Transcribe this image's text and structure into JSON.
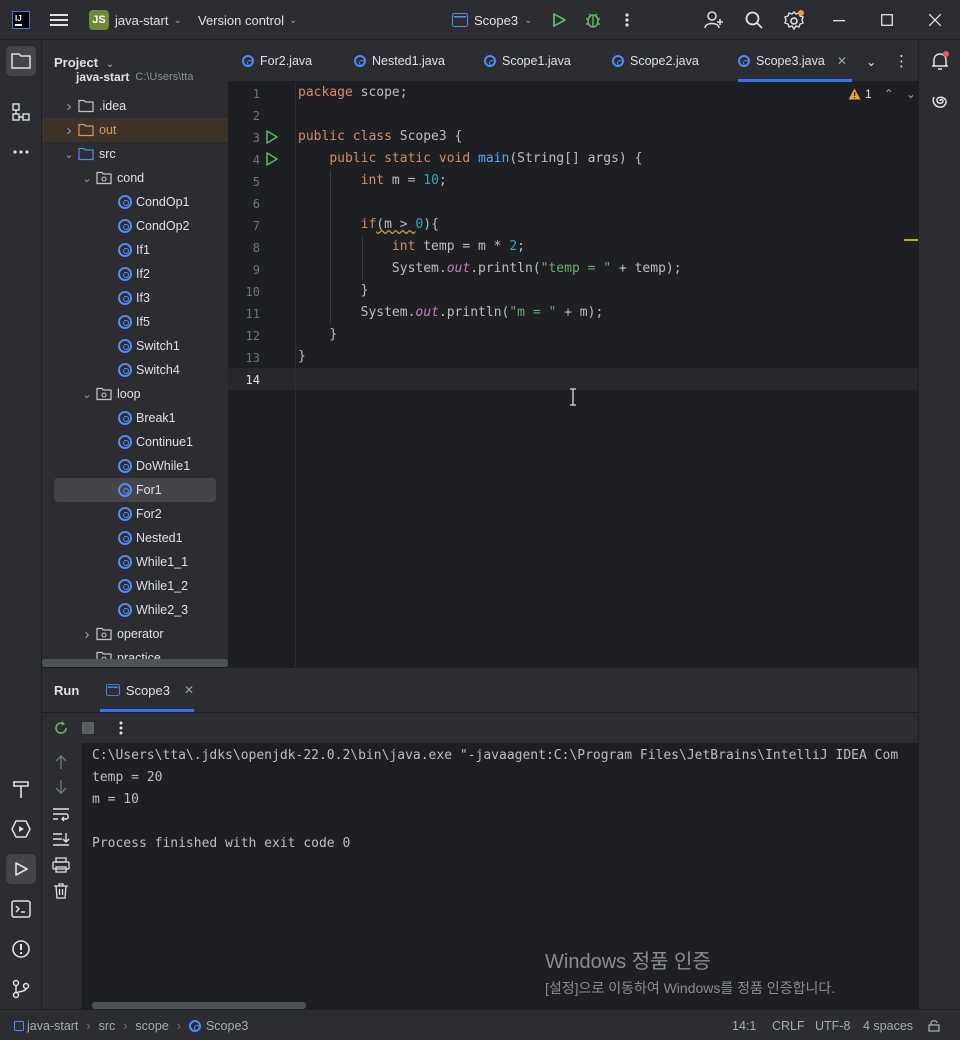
{
  "titlebar": {
    "project_badge": "JS",
    "project_name": "java-start",
    "version_control": "Version control",
    "run_config": "Scope3"
  },
  "project_panel": {
    "title": "Project",
    "root": "java-start",
    "root_path": "C:\\Users\\tta",
    "items": [
      {
        "label": ".idea",
        "kind": "folder"
      },
      {
        "label": "out",
        "kind": "folder-excluded"
      },
      {
        "label": "src",
        "kind": "source-root"
      },
      {
        "label": "cond",
        "kind": "package"
      },
      {
        "label": "CondOp1",
        "kind": "class"
      },
      {
        "label": "CondOp2",
        "kind": "class"
      },
      {
        "label": "If1",
        "kind": "class"
      },
      {
        "label": "If2",
        "kind": "class"
      },
      {
        "label": "If3",
        "kind": "class"
      },
      {
        "label": "If5",
        "kind": "class"
      },
      {
        "label": "Switch1",
        "kind": "class"
      },
      {
        "label": "Switch4",
        "kind": "class"
      },
      {
        "label": "loop",
        "kind": "package"
      },
      {
        "label": "Break1",
        "kind": "class"
      },
      {
        "label": "Continue1",
        "kind": "class"
      },
      {
        "label": "DoWhile1",
        "kind": "class"
      },
      {
        "label": "For1",
        "kind": "class"
      },
      {
        "label": "For2",
        "kind": "class"
      },
      {
        "label": "Nested1",
        "kind": "class"
      },
      {
        "label": "While1_1",
        "kind": "class"
      },
      {
        "label": "While1_2",
        "kind": "class"
      },
      {
        "label": "While2_3",
        "kind": "class"
      },
      {
        "label": "operator",
        "kind": "package"
      },
      {
        "label": "practice",
        "kind": "package"
      }
    ]
  },
  "editor": {
    "tabs": [
      "For2.java",
      "Nested1.java",
      "Scope1.java",
      "Scope2.java",
      "Scope3.java"
    ],
    "active_tab": "Scope3.java",
    "warning_count": "1",
    "line_numbers": [
      "1",
      "2",
      "3",
      "4",
      "5",
      "6",
      "7",
      "8",
      "9",
      "10",
      "11",
      "12",
      "13",
      "14"
    ],
    "code": {
      "l1_kw": "package",
      "l1_rest": " scope;",
      "l3_kw": "public class",
      "l3_rest": " Scope3 {",
      "l4_kw": "public static void",
      "l4_fn": "main",
      "l4_rest": "(String[] args) {",
      "l5_kw": "int",
      "l5_a": " m = ",
      "l5_num": "10",
      "l5_b": ";",
      "l7_kw": "if",
      "l7_a": "(m > ",
      "l7_num": "0",
      "l7_b": "){",
      "l8_kw": "int",
      "l8_a": " temp = m * ",
      "l8_num": "2",
      "l8_b": ";",
      "l9_a": "System.",
      "l9_fld": "out",
      "l9_b": ".println(",
      "l9_str": "\"temp = \"",
      "l9_c": " + temp);",
      "l10": "}",
      "l11_a": "System.",
      "l11_fld": "out",
      "l11_b": ".println(",
      "l11_str": "\"m = \"",
      "l11_c": " + m);",
      "l12": "}",
      "l13": "}"
    }
  },
  "run_panel": {
    "title": "Run",
    "tab": "Scope3",
    "output": [
      "C:\\Users\\tta\\.jdks\\openjdk-22.0.2\\bin\\java.exe \"-javaagent:C:\\Program Files\\JetBrains\\IntelliJ IDEA Com",
      "temp = 20",
      "m = 10",
      "",
      "Process finished with exit code 0"
    ]
  },
  "watermark": {
    "title": "Windows 정품 인증",
    "subtitle": "[설정]으로 이동하여 Windows를 정품 인증합니다."
  },
  "statusbar": {
    "breadcrumb": [
      "java-start",
      "src",
      "scope",
      "Scope3"
    ],
    "position": "14:1",
    "line_sep": "CRLF",
    "encoding": "UTF-8",
    "indent": "4 spaces"
  },
  "colors": {
    "accent": "#3574f0",
    "keyword": "#cf8e6d",
    "number": "#2aacb8",
    "string": "#6aab73",
    "function": "#56a8f5",
    "field": "#c77dbb",
    "run_green": "#5fb865"
  }
}
